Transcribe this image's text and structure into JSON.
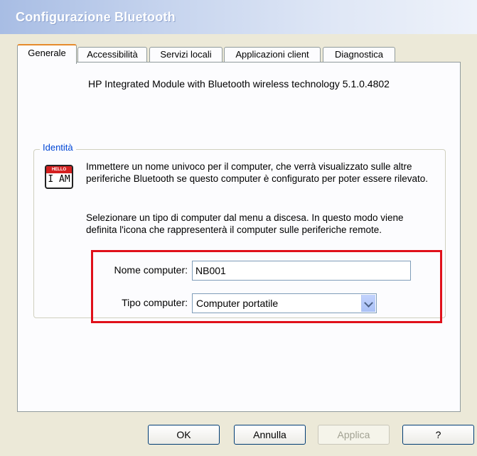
{
  "window": {
    "title": "Configurazione Bluetooth"
  },
  "tabs": [
    {
      "label": "Generale",
      "active": true
    },
    {
      "label": "Accessibilità",
      "active": false
    },
    {
      "label": "Servizi locali",
      "active": false
    },
    {
      "label": "Applicazioni client",
      "active": false
    },
    {
      "label": "Diagnostica",
      "active": false
    }
  ],
  "product": "HP Integrated Module with Bluetooth wireless technology 5.1.0.4802",
  "identity": {
    "legend": "Identità",
    "icon": {
      "name": "hello-i-am-badge-icon",
      "small_text": "HELLO",
      "big_text": "I AM"
    },
    "paragraph1": "Immettere un nome univoco per il computer, che verrà visualizzato sulle altre periferiche Bluetooth se questo computer è configurato per poter essere rilevato.",
    "paragraph2": "Selezionare un tipo di computer dal menu a discesa. In questo modo viene definita l'icona che rappresenterà il computer sulle periferiche remote.",
    "name_label": "Nome computer:",
    "name_value": "NB001",
    "type_label": "Tipo computer:",
    "type_value": "Computer portatile"
  },
  "buttons": {
    "ok": "OK",
    "cancel": "Annulla",
    "apply": "Applica",
    "help": "?"
  },
  "colors": {
    "highlight": "#e0101a",
    "legend": "#0046d5"
  }
}
